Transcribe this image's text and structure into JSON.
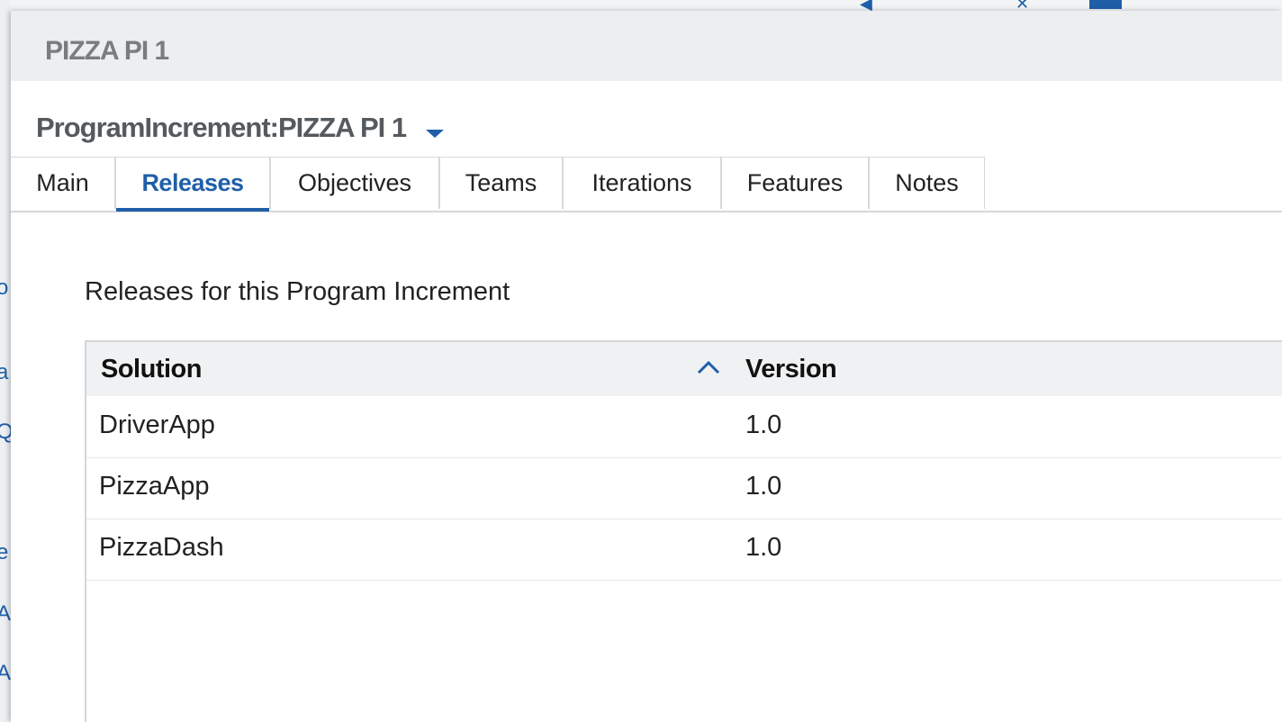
{
  "dialog": {
    "title": "PIZZA PI 1"
  },
  "record": {
    "title": "ProgramIncrement:PIZZA PI 1"
  },
  "tabs": [
    {
      "label": "Main"
    },
    {
      "label": "Releases"
    },
    {
      "label": "Objectives"
    },
    {
      "label": "Teams"
    },
    {
      "label": "Iterations"
    },
    {
      "label": "Features"
    },
    {
      "label": "Notes"
    }
  ],
  "active_tab": "Releases",
  "releases": {
    "section_label": "Releases for this Program Increment",
    "columns": [
      "Solution",
      "Version"
    ],
    "rows": [
      {
        "solution": "DriverApp",
        "version": "1.0"
      },
      {
        "solution": "PizzaApp",
        "version": "1.0"
      },
      {
        "solution": "PizzaDash",
        "version": "1.0"
      }
    ]
  },
  "colors": {
    "accent": "#1f5fa8",
    "title_gray": "#7a7d80",
    "header_bg": "#f0f1f2"
  },
  "icons": {
    "record_menu": "chevron-down-icon",
    "sort": "chevron-up-icon"
  }
}
